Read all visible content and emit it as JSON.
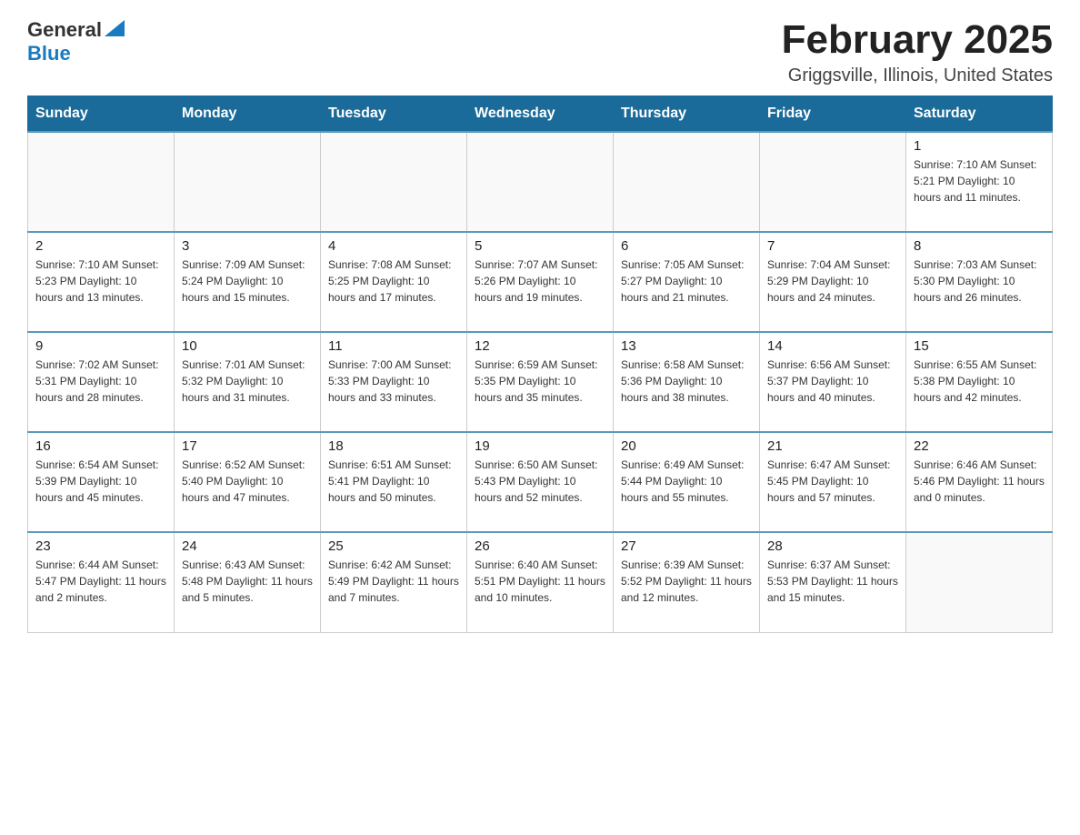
{
  "logo": {
    "general": "General",
    "blue": "Blue",
    "triangle": "▶"
  },
  "title": "February 2025",
  "subtitle": "Griggsville, Illinois, United States",
  "weekdays": [
    "Sunday",
    "Monday",
    "Tuesday",
    "Wednesday",
    "Thursday",
    "Friday",
    "Saturday"
  ],
  "weeks": [
    [
      {
        "day": "",
        "info": ""
      },
      {
        "day": "",
        "info": ""
      },
      {
        "day": "",
        "info": ""
      },
      {
        "day": "",
        "info": ""
      },
      {
        "day": "",
        "info": ""
      },
      {
        "day": "",
        "info": ""
      },
      {
        "day": "1",
        "info": "Sunrise: 7:10 AM\nSunset: 5:21 PM\nDaylight: 10 hours and 11 minutes."
      }
    ],
    [
      {
        "day": "2",
        "info": "Sunrise: 7:10 AM\nSunset: 5:23 PM\nDaylight: 10 hours and 13 minutes."
      },
      {
        "day": "3",
        "info": "Sunrise: 7:09 AM\nSunset: 5:24 PM\nDaylight: 10 hours and 15 minutes."
      },
      {
        "day": "4",
        "info": "Sunrise: 7:08 AM\nSunset: 5:25 PM\nDaylight: 10 hours and 17 minutes."
      },
      {
        "day": "5",
        "info": "Sunrise: 7:07 AM\nSunset: 5:26 PM\nDaylight: 10 hours and 19 minutes."
      },
      {
        "day": "6",
        "info": "Sunrise: 7:05 AM\nSunset: 5:27 PM\nDaylight: 10 hours and 21 minutes."
      },
      {
        "day": "7",
        "info": "Sunrise: 7:04 AM\nSunset: 5:29 PM\nDaylight: 10 hours and 24 minutes."
      },
      {
        "day": "8",
        "info": "Sunrise: 7:03 AM\nSunset: 5:30 PM\nDaylight: 10 hours and 26 minutes."
      }
    ],
    [
      {
        "day": "9",
        "info": "Sunrise: 7:02 AM\nSunset: 5:31 PM\nDaylight: 10 hours and 28 minutes."
      },
      {
        "day": "10",
        "info": "Sunrise: 7:01 AM\nSunset: 5:32 PM\nDaylight: 10 hours and 31 minutes."
      },
      {
        "day": "11",
        "info": "Sunrise: 7:00 AM\nSunset: 5:33 PM\nDaylight: 10 hours and 33 minutes."
      },
      {
        "day": "12",
        "info": "Sunrise: 6:59 AM\nSunset: 5:35 PM\nDaylight: 10 hours and 35 minutes."
      },
      {
        "day": "13",
        "info": "Sunrise: 6:58 AM\nSunset: 5:36 PM\nDaylight: 10 hours and 38 minutes."
      },
      {
        "day": "14",
        "info": "Sunrise: 6:56 AM\nSunset: 5:37 PM\nDaylight: 10 hours and 40 minutes."
      },
      {
        "day": "15",
        "info": "Sunrise: 6:55 AM\nSunset: 5:38 PM\nDaylight: 10 hours and 42 minutes."
      }
    ],
    [
      {
        "day": "16",
        "info": "Sunrise: 6:54 AM\nSunset: 5:39 PM\nDaylight: 10 hours and 45 minutes."
      },
      {
        "day": "17",
        "info": "Sunrise: 6:52 AM\nSunset: 5:40 PM\nDaylight: 10 hours and 47 minutes."
      },
      {
        "day": "18",
        "info": "Sunrise: 6:51 AM\nSunset: 5:41 PM\nDaylight: 10 hours and 50 minutes."
      },
      {
        "day": "19",
        "info": "Sunrise: 6:50 AM\nSunset: 5:43 PM\nDaylight: 10 hours and 52 minutes."
      },
      {
        "day": "20",
        "info": "Sunrise: 6:49 AM\nSunset: 5:44 PM\nDaylight: 10 hours and 55 minutes."
      },
      {
        "day": "21",
        "info": "Sunrise: 6:47 AM\nSunset: 5:45 PM\nDaylight: 10 hours and 57 minutes."
      },
      {
        "day": "22",
        "info": "Sunrise: 6:46 AM\nSunset: 5:46 PM\nDaylight: 11 hours and 0 minutes."
      }
    ],
    [
      {
        "day": "23",
        "info": "Sunrise: 6:44 AM\nSunset: 5:47 PM\nDaylight: 11 hours and 2 minutes."
      },
      {
        "day": "24",
        "info": "Sunrise: 6:43 AM\nSunset: 5:48 PM\nDaylight: 11 hours and 5 minutes."
      },
      {
        "day": "25",
        "info": "Sunrise: 6:42 AM\nSunset: 5:49 PM\nDaylight: 11 hours and 7 minutes."
      },
      {
        "day": "26",
        "info": "Sunrise: 6:40 AM\nSunset: 5:51 PM\nDaylight: 11 hours and 10 minutes."
      },
      {
        "day": "27",
        "info": "Sunrise: 6:39 AM\nSunset: 5:52 PM\nDaylight: 11 hours and 12 minutes."
      },
      {
        "day": "28",
        "info": "Sunrise: 6:37 AM\nSunset: 5:53 PM\nDaylight: 11 hours and 15 minutes."
      },
      {
        "day": "",
        "info": ""
      }
    ]
  ]
}
